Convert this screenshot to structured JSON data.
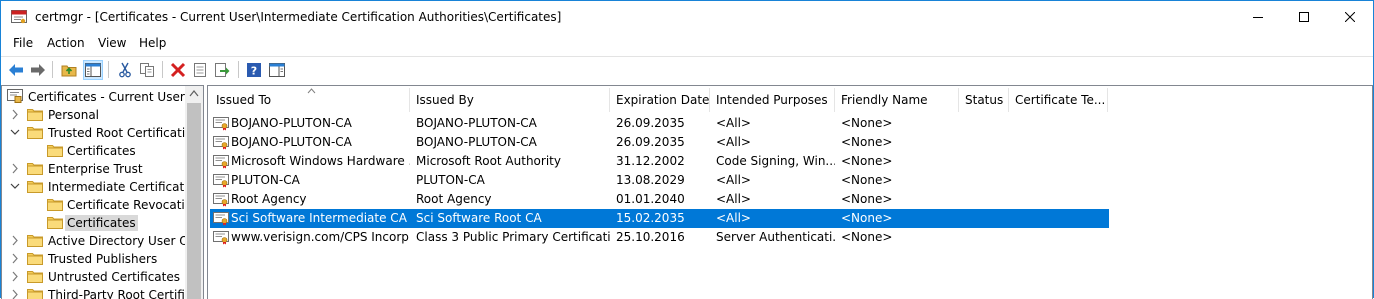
{
  "window": {
    "title": "certmgr - [Certificates - Current User\\Intermediate Certification Authorities\\Certificates]",
    "minimize_icon": "minimize-icon",
    "maximize_icon": "maximize-icon",
    "close_icon": "close-icon"
  },
  "menu": [
    "File",
    "Action",
    "View",
    "Help"
  ],
  "toolbar": {
    "buttons": [
      "back-icon",
      "forward-icon",
      "up-folder-icon",
      "show-hide-tree-icon",
      "cut-icon",
      "copy-icon",
      "delete-icon",
      "properties-icon",
      "export-icon",
      "help-icon",
      "action-pane-icon"
    ]
  },
  "tree": {
    "items": [
      {
        "label": "Certificates - Current User",
        "level": 0,
        "twisty": "none",
        "icon": "cert-store-icon"
      },
      {
        "label": "Personal",
        "level": 1,
        "twisty": "collapsed",
        "icon": "folder-icon"
      },
      {
        "label": "Trusted Root Certification",
        "level": 1,
        "twisty": "expanded",
        "icon": "folder-icon"
      },
      {
        "label": "Certificates",
        "level": 2,
        "twisty": "none",
        "icon": "folder-icon"
      },
      {
        "label": "Enterprise Trust",
        "level": 1,
        "twisty": "collapsed",
        "icon": "folder-icon"
      },
      {
        "label": "Intermediate Certification",
        "level": 1,
        "twisty": "expanded",
        "icon": "folder-icon"
      },
      {
        "label": "Certificate Revocation",
        "level": 2,
        "twisty": "none",
        "icon": "folder-icon"
      },
      {
        "label": "Certificates",
        "level": 2,
        "twisty": "none",
        "icon": "folder-icon",
        "selected": true
      },
      {
        "label": "Active Directory User Obje",
        "level": 1,
        "twisty": "collapsed",
        "icon": "folder-icon"
      },
      {
        "label": "Trusted Publishers",
        "level": 1,
        "twisty": "collapsed",
        "icon": "folder-icon"
      },
      {
        "label": "Untrusted Certificates",
        "level": 1,
        "twisty": "collapsed",
        "icon": "folder-icon"
      },
      {
        "label": "Third-Party Root Certificat",
        "level": 1,
        "twisty": "collapsed",
        "icon": "folder-icon"
      }
    ]
  },
  "list": {
    "columns": [
      "Issued To",
      "Issued By",
      "Expiration Date",
      "Intended Purposes",
      "Friendly Name",
      "Status",
      "Certificate Te..."
    ],
    "rows": [
      [
        "BOJANO-PLUTON-CA",
        "BOJANO-PLUTON-CA",
        "26.09.2035",
        "<All>",
        "<None>",
        "",
        ""
      ],
      [
        "BOJANO-PLUTON-CA",
        "BOJANO-PLUTON-CA",
        "26.09.2035",
        "<All>",
        "<None>",
        "",
        ""
      ],
      [
        "Microsoft Windows Hardware ...",
        "Microsoft Root Authority",
        "31.12.2002",
        "Code Signing, Win...",
        "<None>",
        "",
        ""
      ],
      [
        "PLUTON-CA",
        "PLUTON-CA",
        "13.08.2029",
        "<All>",
        "<None>",
        "",
        ""
      ],
      [
        "Root Agency",
        "Root Agency",
        "01.01.2040",
        "<All>",
        "<None>",
        "",
        ""
      ],
      [
        "Sci Software Intermediate CA",
        "Sci Software Root CA",
        "15.02.2035",
        "<All>",
        "<None>",
        "",
        ""
      ],
      [
        "www.verisign.com/CPS Incorp....",
        "Class 3 Public Primary Certificatio...",
        "25.10.2016",
        "Server Authenticati...",
        "<None>",
        "",
        ""
      ]
    ],
    "selected_row": 5
  },
  "colors": {
    "selection": "#0078d7",
    "tree_selection": "#d9d9d9",
    "border": "#828790"
  }
}
